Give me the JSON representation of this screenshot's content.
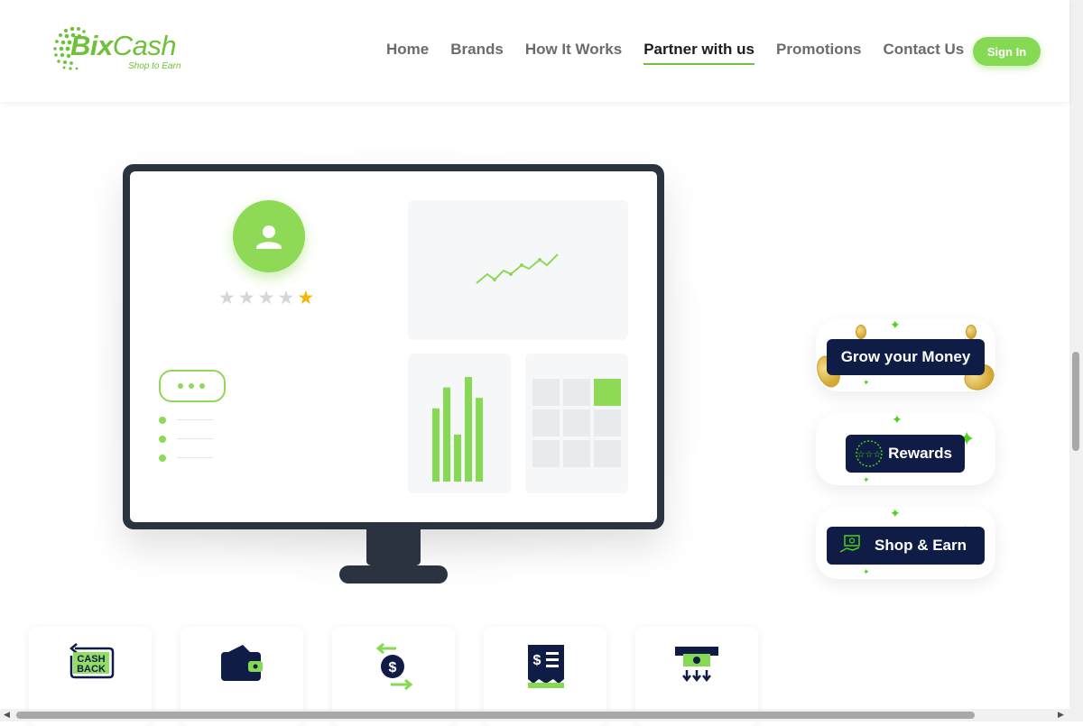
{
  "brand": {
    "name_part1": "Bix",
    "name_part2": "Cash",
    "tagline": "Shop to Earn"
  },
  "nav": {
    "items": [
      {
        "label": "Home",
        "active": false
      },
      {
        "label": "Brands",
        "active": false
      },
      {
        "label": "How It Works",
        "active": false
      },
      {
        "label": "Partner with us",
        "active": true
      },
      {
        "label": "Promotions",
        "active": false
      },
      {
        "label": "Contact Us",
        "active": false
      }
    ],
    "signin_label": "Sign In"
  },
  "illustration": {
    "rating": {
      "filled": 1,
      "total": 5
    },
    "bars": [
      0.7,
      0.9,
      0.45,
      1.0,
      0.8
    ],
    "icons": [
      "user-icon",
      "chat-bubble-icon",
      "line-trend-icon",
      "bar-chart-icon",
      "grid-icon"
    ]
  },
  "badges": [
    {
      "label": "Grow your Money",
      "icon": "coins-icon"
    },
    {
      "label": "Rewards",
      "icon": "stars-circle-icon"
    },
    {
      "label": "Shop & Earn",
      "icon": "hand-cash-icon"
    }
  ],
  "feature_cards": [
    {
      "icon": "cashback-icon",
      "text": "CASH\nBACK"
    },
    {
      "icon": "wallet-icon"
    },
    {
      "icon": "money-exchange-icon",
      "symbol": "$"
    },
    {
      "icon": "receipt-icon",
      "symbol": "$"
    },
    {
      "icon": "atm-withdraw-icon"
    }
  ],
  "colors": {
    "accent": "#86d953",
    "navy": "#0f1c45",
    "monitor": "#2b3240",
    "star": "#f2b705",
    "sparkle": "#4ed01c"
  }
}
